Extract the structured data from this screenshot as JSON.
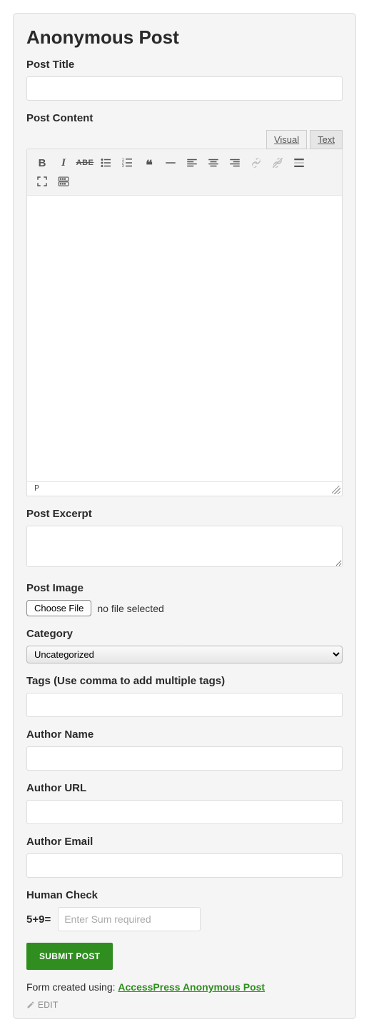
{
  "card": {
    "title": "Anonymous Post"
  },
  "fields": {
    "post_title": {
      "label": "Post Title",
      "value": ""
    },
    "post_content": {
      "label": "Post Content"
    },
    "post_excerpt": {
      "label": "Post Excerpt",
      "value": ""
    },
    "post_image": {
      "label": "Post Image",
      "button": "Choose File",
      "status": "no file selected"
    },
    "category": {
      "label": "Category",
      "selected": "Uncategorized"
    },
    "tags": {
      "label": "Tags (Use comma to add multiple tags)",
      "value": ""
    },
    "author_name": {
      "label": "Author Name",
      "value": ""
    },
    "author_url": {
      "label": "Author URL",
      "value": ""
    },
    "author_email": {
      "label": "Author Email",
      "value": ""
    },
    "human_check": {
      "label": "Human Check",
      "question": "5+9=",
      "placeholder": "Enter Sum required",
      "value": ""
    }
  },
  "editor": {
    "tabs": {
      "visual": "Visual",
      "text": "Text",
      "active": "visual"
    },
    "status_path": "P",
    "toolbar": {
      "row1": [
        "bold",
        "italic",
        "strike",
        "ul",
        "ol",
        "quote",
        "hr",
        "align-left",
        "align-center",
        "align-right",
        "link",
        "unlink",
        "more"
      ],
      "row2": [
        "fullscreen",
        "kitchen-sink"
      ]
    }
  },
  "submit": {
    "label": "SUBMIT POST"
  },
  "credit": {
    "prefix": "Form created using: ",
    "link_text": "AccessPress Anonymous Post"
  },
  "edit": {
    "label": "EDIT"
  }
}
